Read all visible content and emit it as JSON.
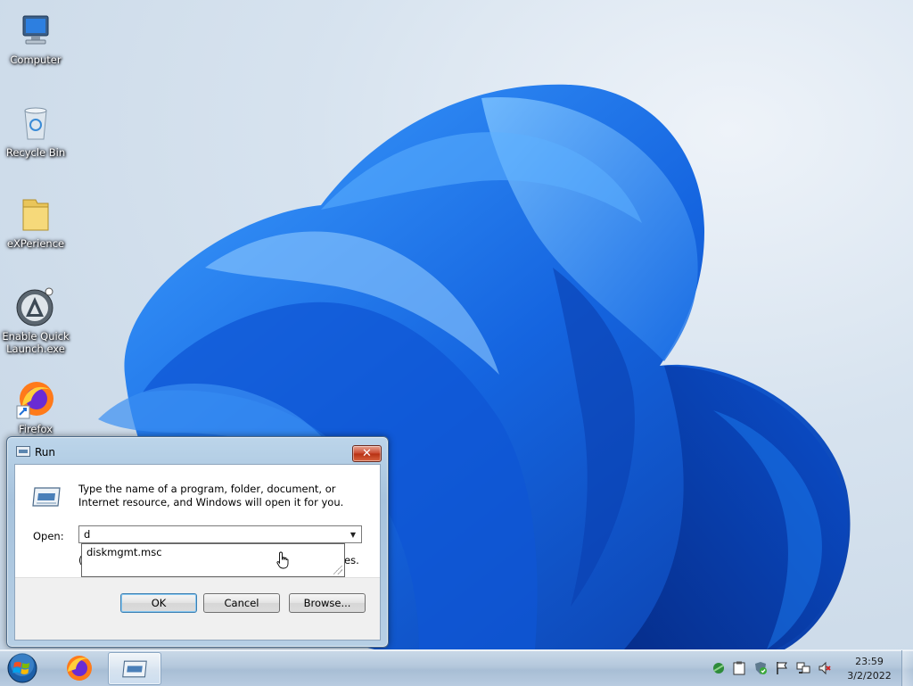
{
  "desktop": {
    "icons": [
      {
        "label": "Computer",
        "icon": "computer-icon"
      },
      {
        "label": "Recycle Bin",
        "icon": "recycle-bin-icon"
      },
      {
        "label": "eXPerience",
        "icon": "folder-icon"
      },
      {
        "label": "Enable Quick Launch.exe",
        "icon": "app-shortcut-icon"
      },
      {
        "label": "Firefox",
        "icon": "firefox-icon"
      }
    ]
  },
  "run_dialog": {
    "title": "Run",
    "description": "Type the name of a program, folder, document, or Internet resource, and Windows will open it for you.",
    "open_label": "Open:",
    "open_value": "d",
    "autocomplete_item": "diskmgmt.msc",
    "hint_fragment_left": "(",
    "hint_fragment_right": "es.",
    "buttons": {
      "ok": "OK",
      "cancel": "Cancel",
      "browse": "Browse..."
    },
    "close_glyph": "✕"
  },
  "taskbar": {
    "items": [
      "start-orb",
      "firefox",
      "run"
    ],
    "tray_icons": [
      "network-install-icon",
      "clipboard-icon",
      "shield-check-icon",
      "flag-icon",
      "network-icon",
      "volume-muted-icon"
    ],
    "clock": {
      "time": "23:59",
      "date": "3/2/2022"
    }
  },
  "colors": {
    "wallpaper_bloom": "#1565e0",
    "window_frame": "#a7c3dd",
    "close_button": "#c9462c",
    "taskbar": "#b4c8dc"
  }
}
